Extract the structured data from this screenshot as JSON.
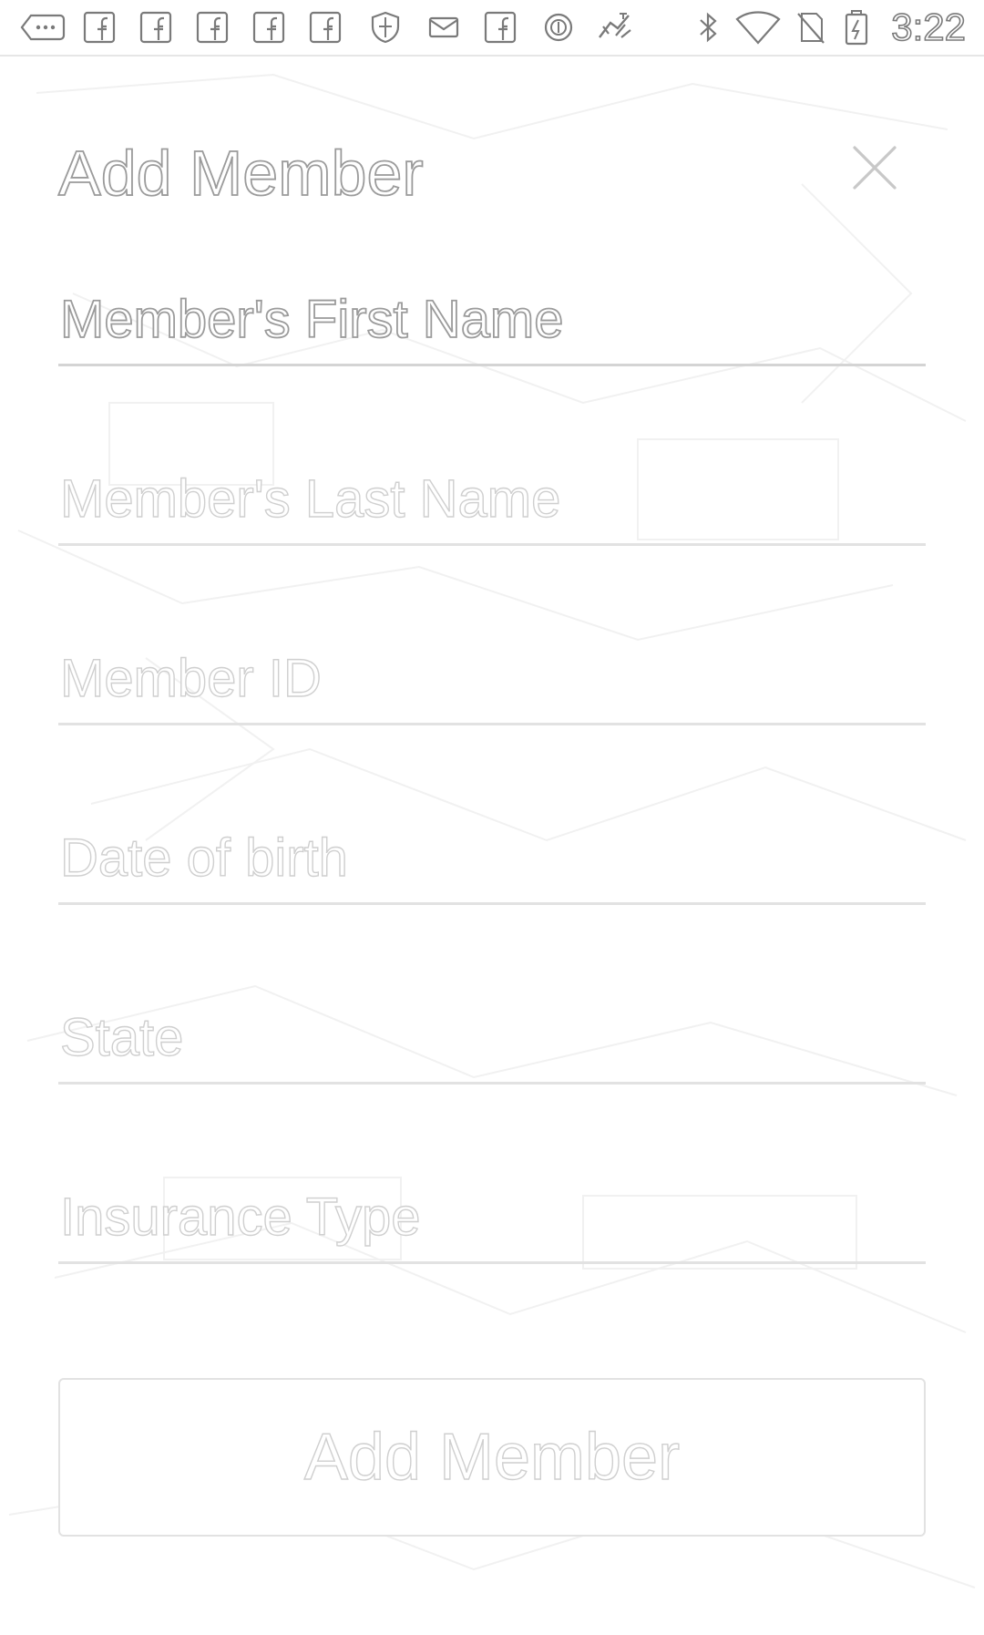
{
  "status_bar": {
    "time": "3:22",
    "left_icons": [
      "more-icon",
      "facebook-icon",
      "facebook-icon",
      "facebook-icon",
      "facebook-icon",
      "facebook-icon",
      "shield-icon",
      "mail-icon",
      "facebook-icon",
      "circle-icon",
      "fax-icon"
    ],
    "right_icons": [
      "bluetooth-icon",
      "wifi-icon",
      "no-sim-icon",
      "battery-charging-icon"
    ]
  },
  "dialog": {
    "title": "Add Member",
    "close_icon": "close-icon"
  },
  "form": {
    "first_name": {
      "placeholder": "Member's First Name",
      "value": ""
    },
    "last_name": {
      "placeholder": "Member's Last Name",
      "value": ""
    },
    "member_id": {
      "placeholder": "Member ID",
      "value": ""
    },
    "dob": {
      "placeholder": "Date of birth",
      "value": ""
    },
    "state": {
      "placeholder": "State",
      "value": ""
    },
    "insurance_type": {
      "placeholder": "Insurance Type",
      "value": ""
    }
  },
  "submit": {
    "label": "Add Member"
  }
}
